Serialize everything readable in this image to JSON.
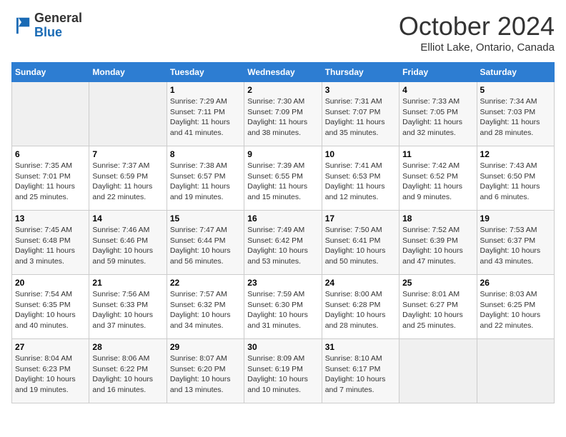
{
  "header": {
    "logo_general": "General",
    "logo_blue": "Blue",
    "month_title": "October 2024",
    "subtitle": "Elliot Lake, Ontario, Canada"
  },
  "days_of_week": [
    "Sunday",
    "Monday",
    "Tuesday",
    "Wednesday",
    "Thursday",
    "Friday",
    "Saturday"
  ],
  "weeks": [
    [
      {
        "day": "",
        "info": ""
      },
      {
        "day": "",
        "info": ""
      },
      {
        "day": "1",
        "info": "Sunrise: 7:29 AM\nSunset: 7:11 PM\nDaylight: 11 hours and 41 minutes."
      },
      {
        "day": "2",
        "info": "Sunrise: 7:30 AM\nSunset: 7:09 PM\nDaylight: 11 hours and 38 minutes."
      },
      {
        "day": "3",
        "info": "Sunrise: 7:31 AM\nSunset: 7:07 PM\nDaylight: 11 hours and 35 minutes."
      },
      {
        "day": "4",
        "info": "Sunrise: 7:33 AM\nSunset: 7:05 PM\nDaylight: 11 hours and 32 minutes."
      },
      {
        "day": "5",
        "info": "Sunrise: 7:34 AM\nSunset: 7:03 PM\nDaylight: 11 hours and 28 minutes."
      }
    ],
    [
      {
        "day": "6",
        "info": "Sunrise: 7:35 AM\nSunset: 7:01 PM\nDaylight: 11 hours and 25 minutes."
      },
      {
        "day": "7",
        "info": "Sunrise: 7:37 AM\nSunset: 6:59 PM\nDaylight: 11 hours and 22 minutes."
      },
      {
        "day": "8",
        "info": "Sunrise: 7:38 AM\nSunset: 6:57 PM\nDaylight: 11 hours and 19 minutes."
      },
      {
        "day": "9",
        "info": "Sunrise: 7:39 AM\nSunset: 6:55 PM\nDaylight: 11 hours and 15 minutes."
      },
      {
        "day": "10",
        "info": "Sunrise: 7:41 AM\nSunset: 6:53 PM\nDaylight: 11 hours and 12 minutes."
      },
      {
        "day": "11",
        "info": "Sunrise: 7:42 AM\nSunset: 6:52 PM\nDaylight: 11 hours and 9 minutes."
      },
      {
        "day": "12",
        "info": "Sunrise: 7:43 AM\nSunset: 6:50 PM\nDaylight: 11 hours and 6 minutes."
      }
    ],
    [
      {
        "day": "13",
        "info": "Sunrise: 7:45 AM\nSunset: 6:48 PM\nDaylight: 11 hours and 3 minutes."
      },
      {
        "day": "14",
        "info": "Sunrise: 7:46 AM\nSunset: 6:46 PM\nDaylight: 10 hours and 59 minutes."
      },
      {
        "day": "15",
        "info": "Sunrise: 7:47 AM\nSunset: 6:44 PM\nDaylight: 10 hours and 56 minutes."
      },
      {
        "day": "16",
        "info": "Sunrise: 7:49 AM\nSunset: 6:42 PM\nDaylight: 10 hours and 53 minutes."
      },
      {
        "day": "17",
        "info": "Sunrise: 7:50 AM\nSunset: 6:41 PM\nDaylight: 10 hours and 50 minutes."
      },
      {
        "day": "18",
        "info": "Sunrise: 7:52 AM\nSunset: 6:39 PM\nDaylight: 10 hours and 47 minutes."
      },
      {
        "day": "19",
        "info": "Sunrise: 7:53 AM\nSunset: 6:37 PM\nDaylight: 10 hours and 43 minutes."
      }
    ],
    [
      {
        "day": "20",
        "info": "Sunrise: 7:54 AM\nSunset: 6:35 PM\nDaylight: 10 hours and 40 minutes."
      },
      {
        "day": "21",
        "info": "Sunrise: 7:56 AM\nSunset: 6:33 PM\nDaylight: 10 hours and 37 minutes."
      },
      {
        "day": "22",
        "info": "Sunrise: 7:57 AM\nSunset: 6:32 PM\nDaylight: 10 hours and 34 minutes."
      },
      {
        "day": "23",
        "info": "Sunrise: 7:59 AM\nSunset: 6:30 PM\nDaylight: 10 hours and 31 minutes."
      },
      {
        "day": "24",
        "info": "Sunrise: 8:00 AM\nSunset: 6:28 PM\nDaylight: 10 hours and 28 minutes."
      },
      {
        "day": "25",
        "info": "Sunrise: 8:01 AM\nSunset: 6:27 PM\nDaylight: 10 hours and 25 minutes."
      },
      {
        "day": "26",
        "info": "Sunrise: 8:03 AM\nSunset: 6:25 PM\nDaylight: 10 hours and 22 minutes."
      }
    ],
    [
      {
        "day": "27",
        "info": "Sunrise: 8:04 AM\nSunset: 6:23 PM\nDaylight: 10 hours and 19 minutes."
      },
      {
        "day": "28",
        "info": "Sunrise: 8:06 AM\nSunset: 6:22 PM\nDaylight: 10 hours and 16 minutes."
      },
      {
        "day": "29",
        "info": "Sunrise: 8:07 AM\nSunset: 6:20 PM\nDaylight: 10 hours and 13 minutes."
      },
      {
        "day": "30",
        "info": "Sunrise: 8:09 AM\nSunset: 6:19 PM\nDaylight: 10 hours and 10 minutes."
      },
      {
        "day": "31",
        "info": "Sunrise: 8:10 AM\nSunset: 6:17 PM\nDaylight: 10 hours and 7 minutes."
      },
      {
        "day": "",
        "info": ""
      },
      {
        "day": "",
        "info": ""
      }
    ]
  ]
}
